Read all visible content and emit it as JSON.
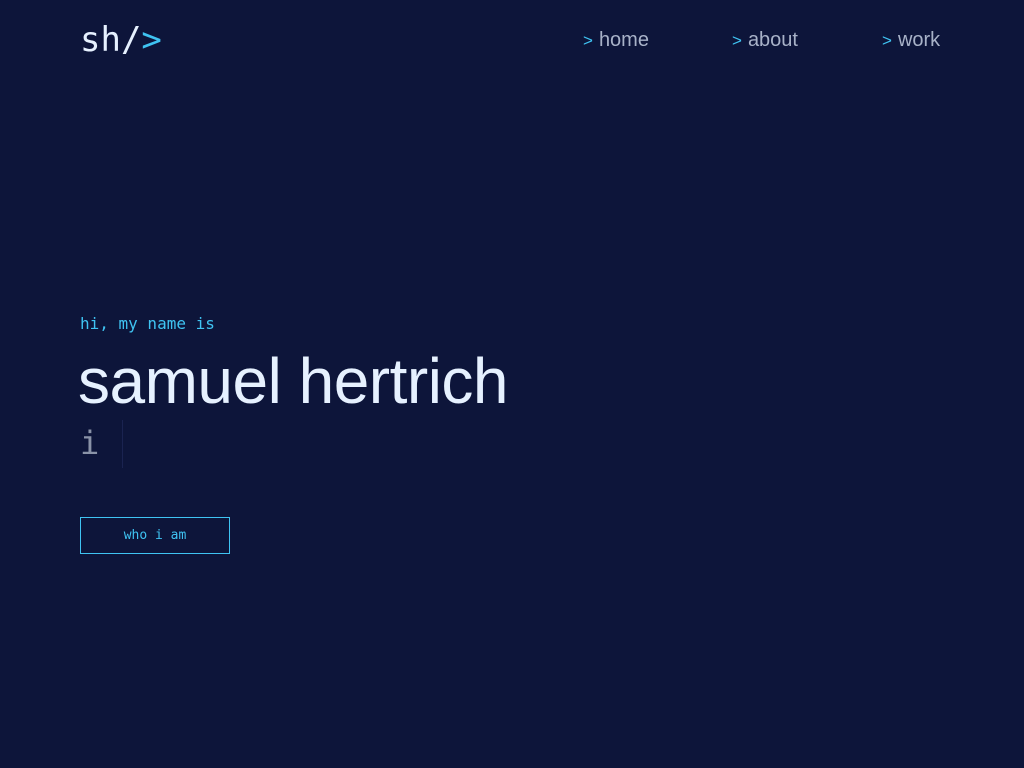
{
  "header": {
    "logo_text": "sh/",
    "logo_accent": ">"
  },
  "nav": {
    "prompt_symbol": ">",
    "items": [
      {
        "label": "home"
      },
      {
        "label": "about"
      },
      {
        "label": "work"
      }
    ]
  },
  "hero": {
    "intro": "hi, my name is",
    "name": "samuel hertrich",
    "typed_text": "i",
    "cta_label": "who i am"
  },
  "colors": {
    "background": "#0d153a",
    "accent": "#3fc3f2",
    "heading": "#e6f1ff",
    "muted": "#a8b2c8"
  }
}
